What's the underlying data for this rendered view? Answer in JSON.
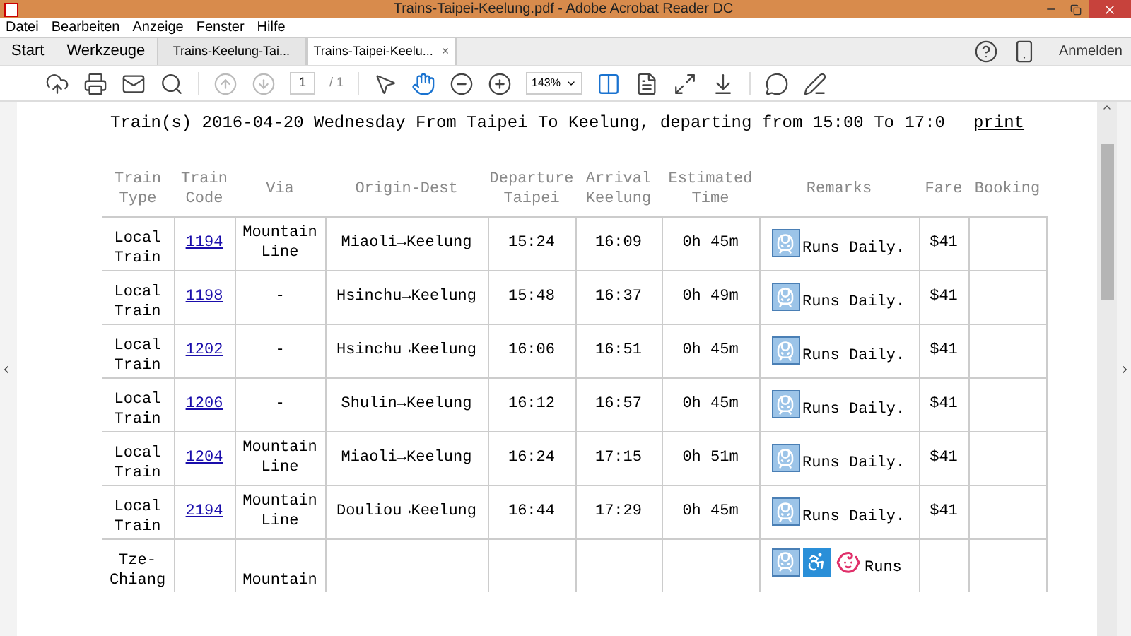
{
  "window": {
    "title": "Trains-Taipei-Keelung.pdf - Adobe Acrobat Reader DC"
  },
  "menu": [
    "Datei",
    "Bearbeiten",
    "Anzeige",
    "Fenster",
    "Hilfe"
  ],
  "tabs": [
    {
      "label": "Start",
      "kind": "home",
      "selected": false
    },
    {
      "label": "Werkzeuge",
      "kind": "home",
      "selected": false
    },
    {
      "label": "Trains-Keelung-Tai...",
      "kind": "doc",
      "selected": false
    },
    {
      "label": "Trains-Taipei-Keelu...",
      "kind": "doc",
      "selected": true
    }
  ],
  "close_tab": "×",
  "sign_in": "Anmelden",
  "toolbar": {
    "page": "1",
    "page_total": "/ 1",
    "zoom": "143%",
    "hand_tool_on": true,
    "prev_page_disabled": true
  },
  "document": {
    "title": "Train(s) 2016-04-20 Wednesday From Taipei To Keelung, departing from 15:00 To 17:0",
    "print_link": "print",
    "columns": [
      "Train\nType",
      "Train\nCode",
      "Via",
      "Origin-Dest",
      "Departure\nTaipei",
      "Arrival\nKeelung",
      "Estimated\nTime",
      "Remarks",
      "Fare",
      "Booking"
    ],
    "rows": [
      {
        "type": "Local\nTrain",
        "code": "1194",
        "via": "Mountain\nLine",
        "origin_dest": "Miaoli→Keelung",
        "departure": "15:24",
        "arrival": "16:09",
        "estimated": "0h 45m",
        "icons": [
          {
            "kind": "train"
          }
        ],
        "remark": "Runs Daily.",
        "fare": "$41"
      },
      {
        "type": "Local\nTrain",
        "code": "1198",
        "via": "-",
        "origin_dest": "Hsinchu→Keelung",
        "departure": "15:48",
        "arrival": "16:37",
        "estimated": "0h 49m",
        "icons": [
          {
            "kind": "train"
          }
        ],
        "remark": "Runs Daily.",
        "fare": "$41"
      },
      {
        "type": "Local\nTrain",
        "code": "1202",
        "via": "-",
        "origin_dest": "Hsinchu→Keelung",
        "departure": "16:06",
        "arrival": "16:51",
        "estimated": "0h 45m",
        "icons": [
          {
            "kind": "train"
          }
        ],
        "remark": "Runs Daily.",
        "fare": "$41"
      },
      {
        "type": "Local\nTrain",
        "code": "1206",
        "via": "-",
        "origin_dest": "Shulin→Keelung",
        "departure": "16:12",
        "arrival": "16:57",
        "estimated": "0h 45m",
        "icons": [
          {
            "kind": "train"
          }
        ],
        "remark": "Runs Daily.",
        "fare": "$41"
      },
      {
        "type": "Local\nTrain",
        "code": "1204",
        "via": "Mountain\nLine",
        "origin_dest": "Miaoli→Keelung",
        "departure": "16:24",
        "arrival": "17:15",
        "estimated": "0h 51m",
        "icons": [
          {
            "kind": "train"
          }
        ],
        "remark": "Runs Daily.",
        "fare": "$41"
      },
      {
        "type": "Local\nTrain",
        "code": "2194",
        "via": "Mountain\nLine",
        "origin_dest": "Douliou→Keelung",
        "departure": "16:44",
        "arrival": "17:29",
        "estimated": "0h 45m",
        "icons": [
          {
            "kind": "train"
          }
        ],
        "remark": "Runs Daily.",
        "fare": "$41"
      },
      {
        "type": "Tze-\nChiang",
        "via": "Mountain",
        "icons": [
          {
            "kind": "train"
          },
          {
            "kind": "wheelchair"
          },
          {
            "kind": "nursing"
          }
        ],
        "remark": "Runs"
      }
    ]
  }
}
